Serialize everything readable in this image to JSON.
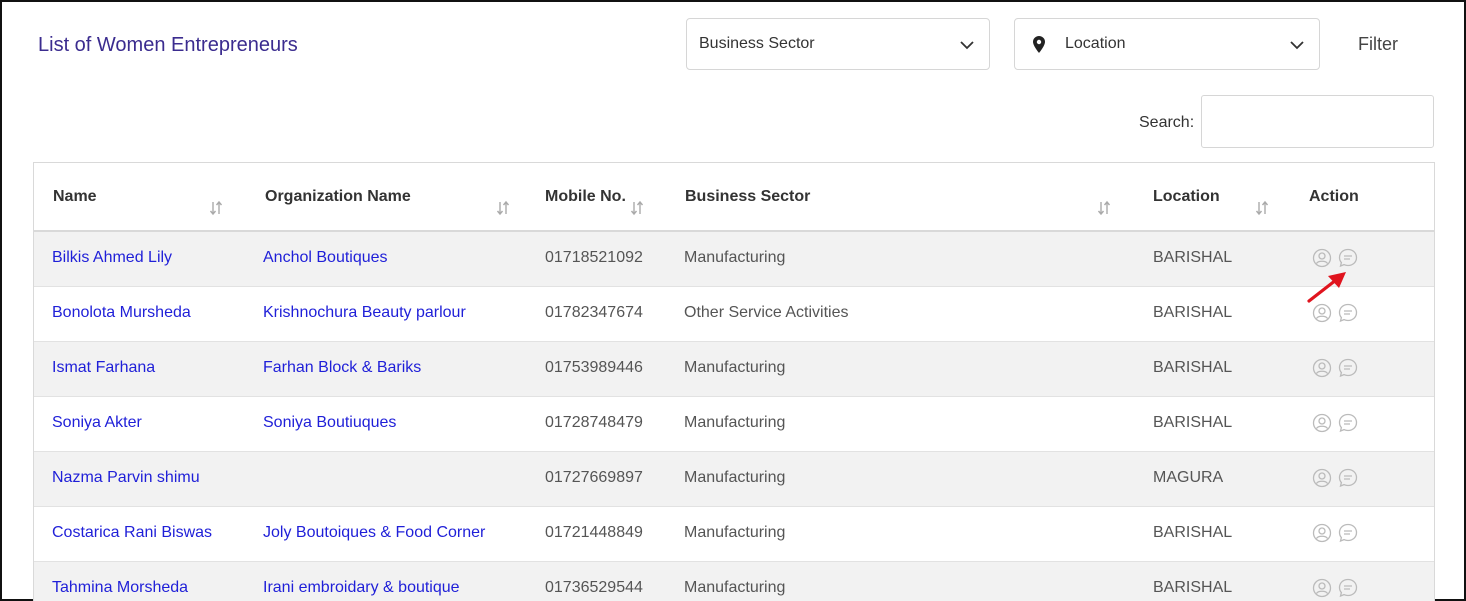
{
  "page_title": "List of Women Entrepreneurs",
  "filters": {
    "business_sector_placeholder": "Business Sector",
    "location_placeholder": "Location",
    "filter_label": "Filter"
  },
  "search": {
    "label": "Search:",
    "value": ""
  },
  "table": {
    "columns": [
      "Name",
      "Organization Name",
      "Mobile No.",
      "Business Sector",
      "Location",
      "Action"
    ],
    "rows": [
      {
        "name": "Bilkis Ahmed Lily",
        "org": "Anchol Boutiques",
        "mobile": "01718521092",
        "sector": "Manufacturing",
        "location": "BARISHAL"
      },
      {
        "name": "Bonolota Mursheda",
        "org": "Krishnochura Beauty parlour",
        "mobile": "01782347674",
        "sector": "Other Service Activities",
        "location": "BARISHAL"
      },
      {
        "name": "Ismat Farhana",
        "org": "Farhan Block & Bariks",
        "mobile": "01753989446",
        "sector": "Manufacturing",
        "location": "BARISHAL"
      },
      {
        "name": "Soniya Akter",
        "org": "Soniya Boutiuques",
        "mobile": "01728748479",
        "sector": "Manufacturing",
        "location": "BARISHAL"
      },
      {
        "name": "Nazma Parvin shimu",
        "org": "",
        "mobile": "01727669897",
        "sector": "Manufacturing",
        "location": "MAGURA"
      },
      {
        "name": "Costarica Rani Biswas",
        "org": "Joly Boutoiques & Food Corner",
        "mobile": "01721448849",
        "sector": "Manufacturing",
        "location": "BARISHAL"
      },
      {
        "name": "Tahmina Morsheda",
        "org": "Irani embroidary & boutique",
        "mobile": "01736529544",
        "sector": "Manufacturing",
        "location": "BARISHAL"
      }
    ]
  },
  "colors": {
    "title": "#3b2c8f",
    "link": "#1f1fd8",
    "row_alt": "#f2f2f2",
    "annotation_arrow": "#e0141e"
  },
  "icons": [
    "chevron-down-icon",
    "map-marker-icon",
    "sort-icon",
    "user-circle-icon",
    "message-icon",
    "red-arrow-annotation"
  ]
}
